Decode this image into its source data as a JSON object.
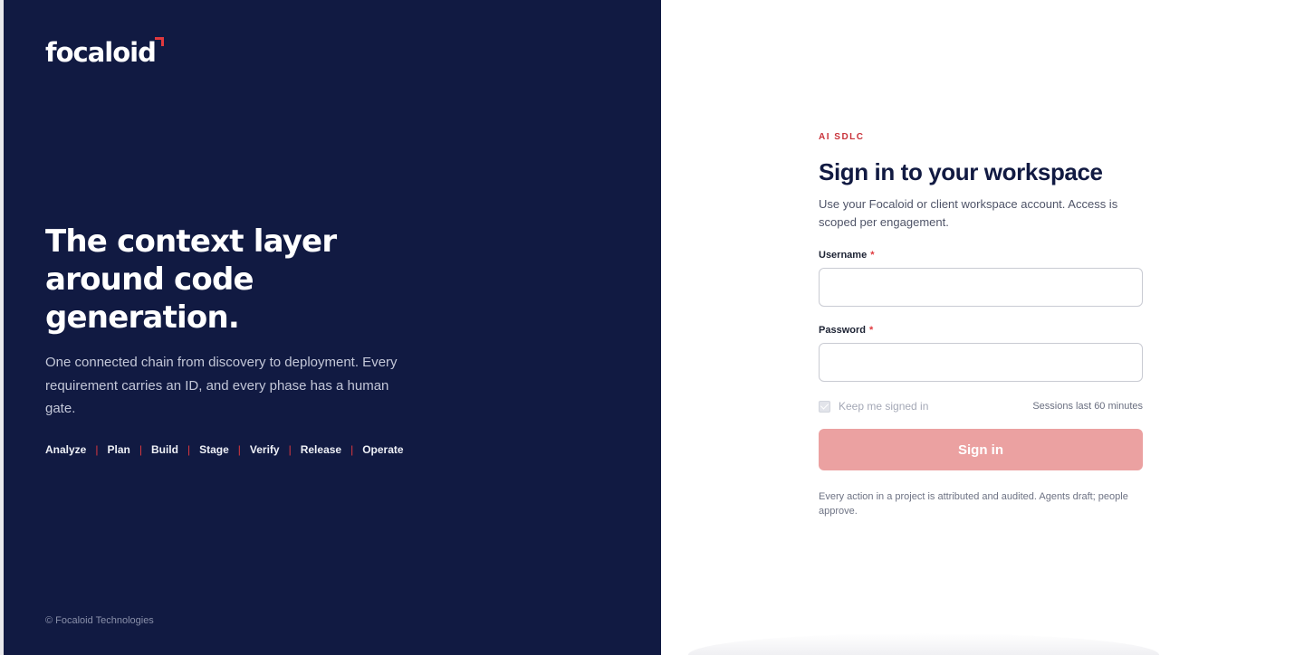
{
  "brand": {
    "logo_text": "focaloid",
    "accent_color": "#e0393e",
    "panel_color": "#111a42"
  },
  "hero": {
    "title": "The context layer around code generation.",
    "subtitle": "One connected chain from discovery to deployment. Every requirement carries an ID, and every phase has a human gate.",
    "phases": [
      "Analyze",
      "Plan",
      "Build",
      "Stage",
      "Verify",
      "Release",
      "Operate"
    ],
    "separator": "|"
  },
  "footer": {
    "copyright": "© Focaloid Technologies"
  },
  "form": {
    "eyebrow": "AI SDLC",
    "title": "Sign in to your workspace",
    "description": "Use your Focaloid or client workspace account. Access is scoped per engagement.",
    "username_label": "Username",
    "username_value": "",
    "password_label": "Password",
    "password_value": "",
    "required_marker": "*",
    "keep_signed_in_label": "Keep me signed in",
    "keep_signed_in_checked": true,
    "session_note": "Sessions last 60 minutes",
    "submit_label": "Sign in",
    "submit_color": "#eba1a1",
    "footnote": "Every action in a project is attributed and audited. Agents draft; people approve."
  }
}
